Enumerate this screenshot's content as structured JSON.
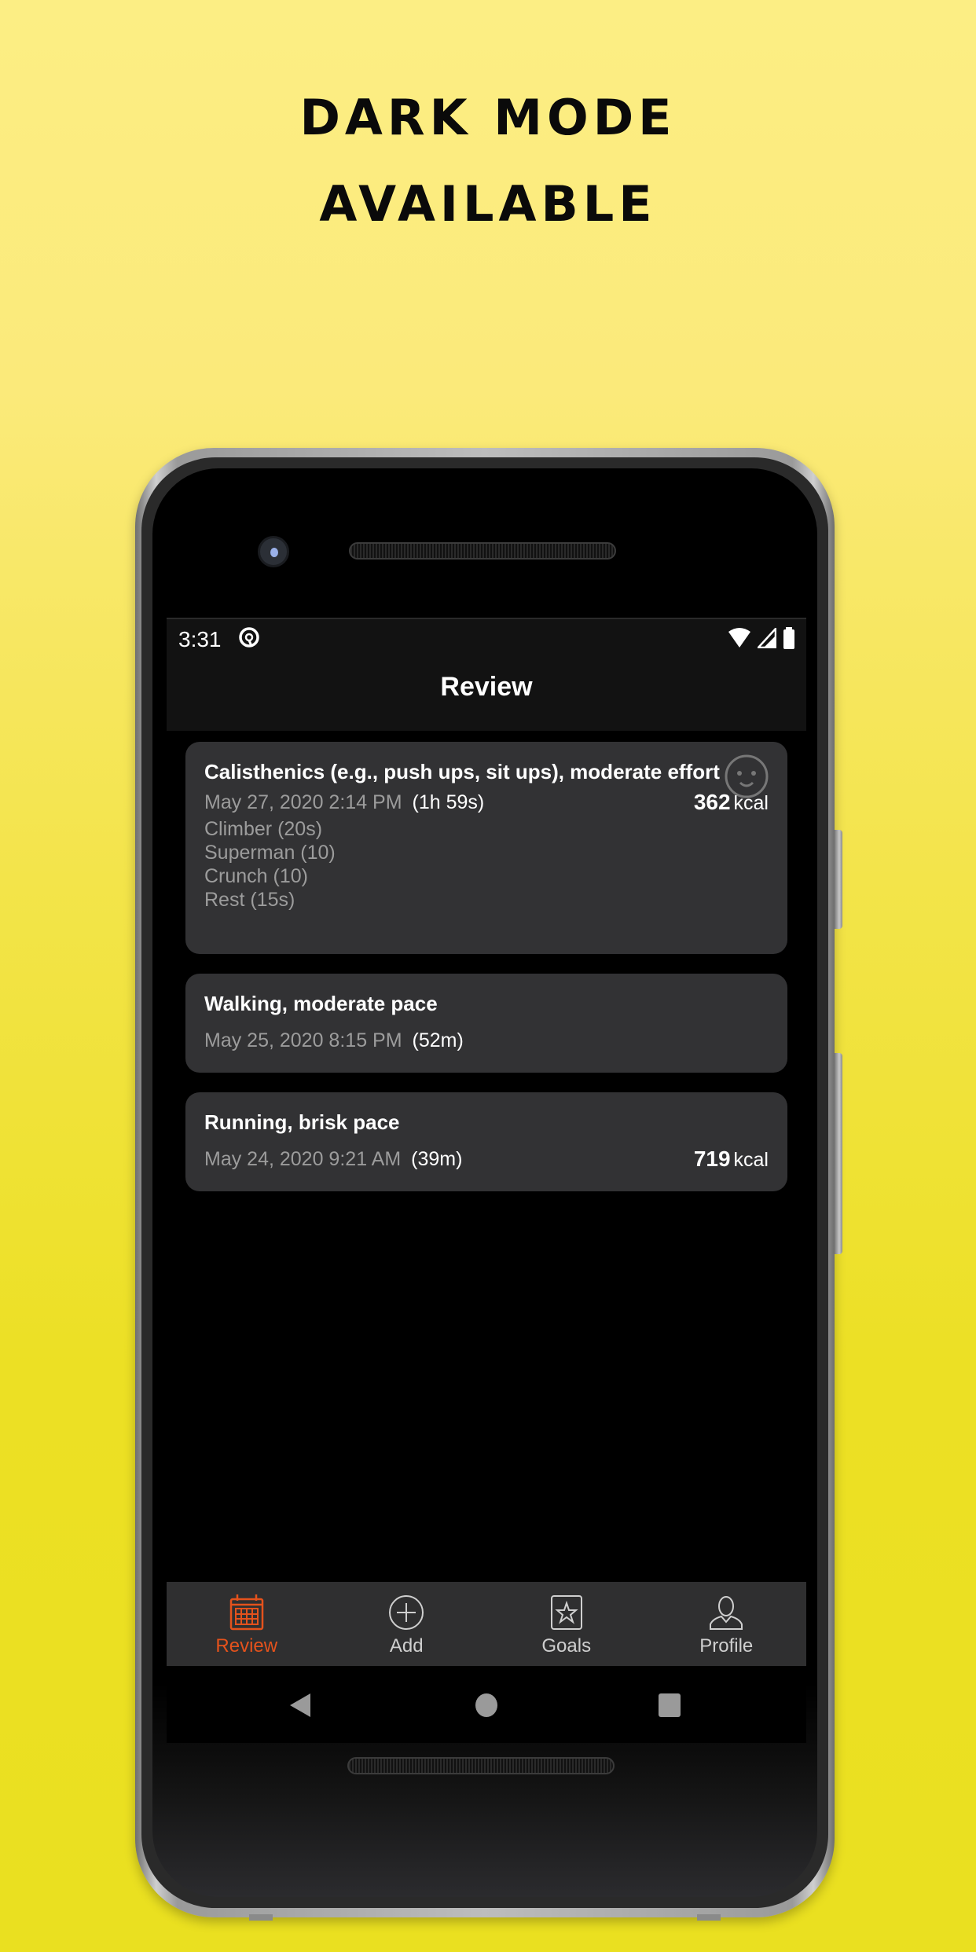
{
  "promo": {
    "line1": "DARK MODE",
    "line2": "AVAILABLE"
  },
  "statusbar": {
    "time": "3:31",
    "icons": [
      "data-saver-icon",
      "wifi-icon",
      "signal-icon",
      "battery-icon"
    ]
  },
  "appbar": {
    "title": "Review"
  },
  "workouts": [
    {
      "title": "Calisthenics (e.g., push ups, sit ups), moderate effort",
      "date": "May 27, 2020 2:14 PM",
      "duration": "(1h 59s)",
      "kcal_value": "362",
      "kcal_unit": "kcal",
      "mood_icon": "smiley-face-icon",
      "exercises": [
        "Climber (20s)",
        "Superman (10)",
        "Crunch (10)",
        "Rest (15s)"
      ]
    },
    {
      "title": "Walking, moderate pace",
      "date": "May 25, 2020 8:15 PM",
      "duration": "(52m)"
    },
    {
      "title": "Running, brisk pace",
      "date": "May 24, 2020 9:21 AM",
      "duration": "(39m)",
      "kcal_value": "719",
      "kcal_unit": "kcal"
    }
  ],
  "bottom_nav": {
    "active_color": "#e4521c",
    "items": [
      {
        "label": "Review",
        "icon": "calendar-icon",
        "active": true
      },
      {
        "label": "Add",
        "icon": "add-circle-icon",
        "active": false
      },
      {
        "label": "Goals",
        "icon": "star-badge-icon",
        "active": false
      },
      {
        "label": "Profile",
        "icon": "person-icon",
        "active": false
      }
    ]
  },
  "system_nav": [
    "back-icon",
    "home-icon",
    "recents-icon"
  ]
}
